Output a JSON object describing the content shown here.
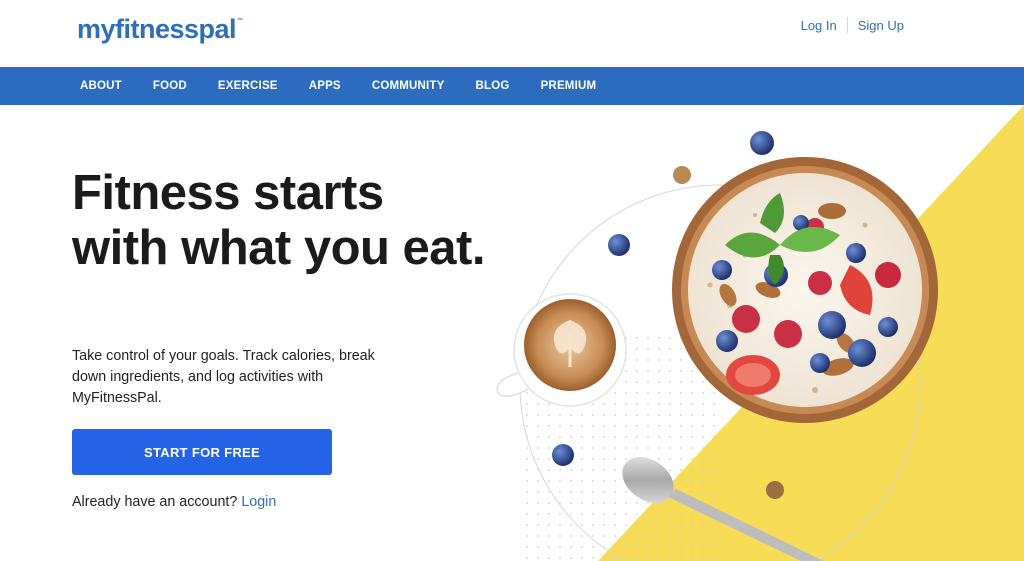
{
  "brand": {
    "logo_text": "myfitnesspal",
    "trademark": "™"
  },
  "auth": {
    "login_label": "Log In",
    "signup_label": "Sign Up"
  },
  "nav": {
    "items": [
      {
        "label": "ABOUT"
      },
      {
        "label": "FOOD"
      },
      {
        "label": "EXERCISE"
      },
      {
        "label": "APPS"
      },
      {
        "label": "COMMUNITY"
      },
      {
        "label": "BLOG"
      },
      {
        "label": "PREMIUM"
      }
    ]
  },
  "hero": {
    "headline": "Fitness starts with what you eat.",
    "subtext": "Take control of your goals. Track calories, break down ingredients, and log activities with MyFitnessPal.",
    "cta_label": "START FOR FREE",
    "account_prompt": "Already have an account?",
    "login_link": "Login"
  },
  "colors": {
    "brand_blue": "#2f6fb8",
    "nav_blue": "#2c6cbf",
    "cta_blue": "#2563e6",
    "accent_yellow": "#f7dc55"
  },
  "images": {
    "hero_art": "oatmeal-bowl-berries-coffee-spoon"
  }
}
